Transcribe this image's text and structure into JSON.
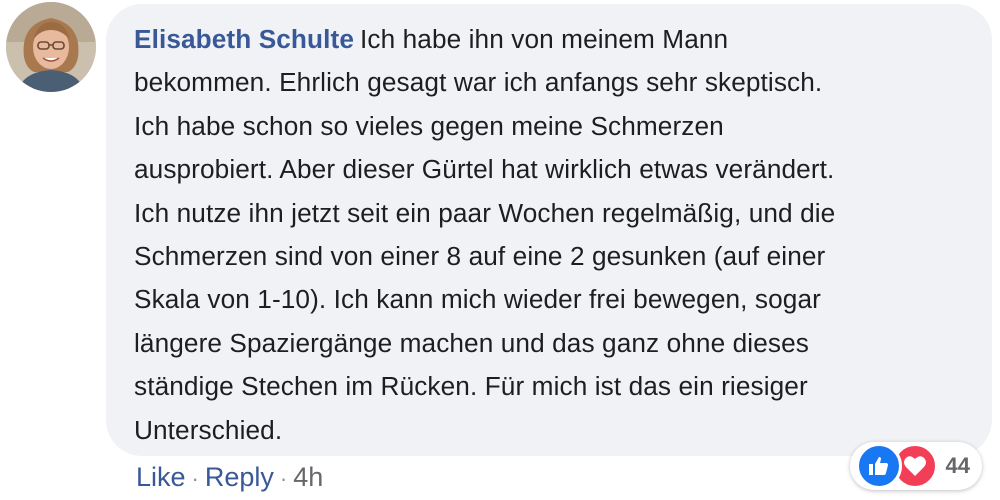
{
  "comment": {
    "author": "Elisabeth Schulte",
    "lines": [
      "Ich habe ihn von meinem Mann",
      "bekommen. Ehrlich gesagt war ich anfangs sehr skeptisch.",
      "Ich habe schon so vieles gegen meine Schmerzen",
      "ausprobiert. Aber dieser Gürtel hat wirklich etwas verändert.",
      "Ich nutze ihn jetzt seit ein paar Wochen regelmäßig, und die",
      "Schmerzen sind von einer 8 auf eine 2 gesunken (auf einer",
      "Skala von 1-10). Ich kann mich wieder frei bewegen, sogar",
      "längere Spaziergänge machen und das ganz ohne dieses",
      "ständige Stechen im Rücken. Für mich ist das ein riesiger",
      "Unterschied."
    ]
  },
  "reactions": {
    "count": "44",
    "icons": [
      "like-icon",
      "love-icon"
    ],
    "colors": {
      "like": "#1877f2",
      "love": "#f33e58"
    }
  },
  "actions": {
    "like_label": "Like",
    "separator": "·",
    "reply_label": "Reply",
    "timestamp": "4h"
  },
  "theme": {
    "bubble_bg": "#f0f2f5",
    "name_color": "#385898",
    "text_color": "#1c1e21",
    "meta_color": "#65676b"
  }
}
